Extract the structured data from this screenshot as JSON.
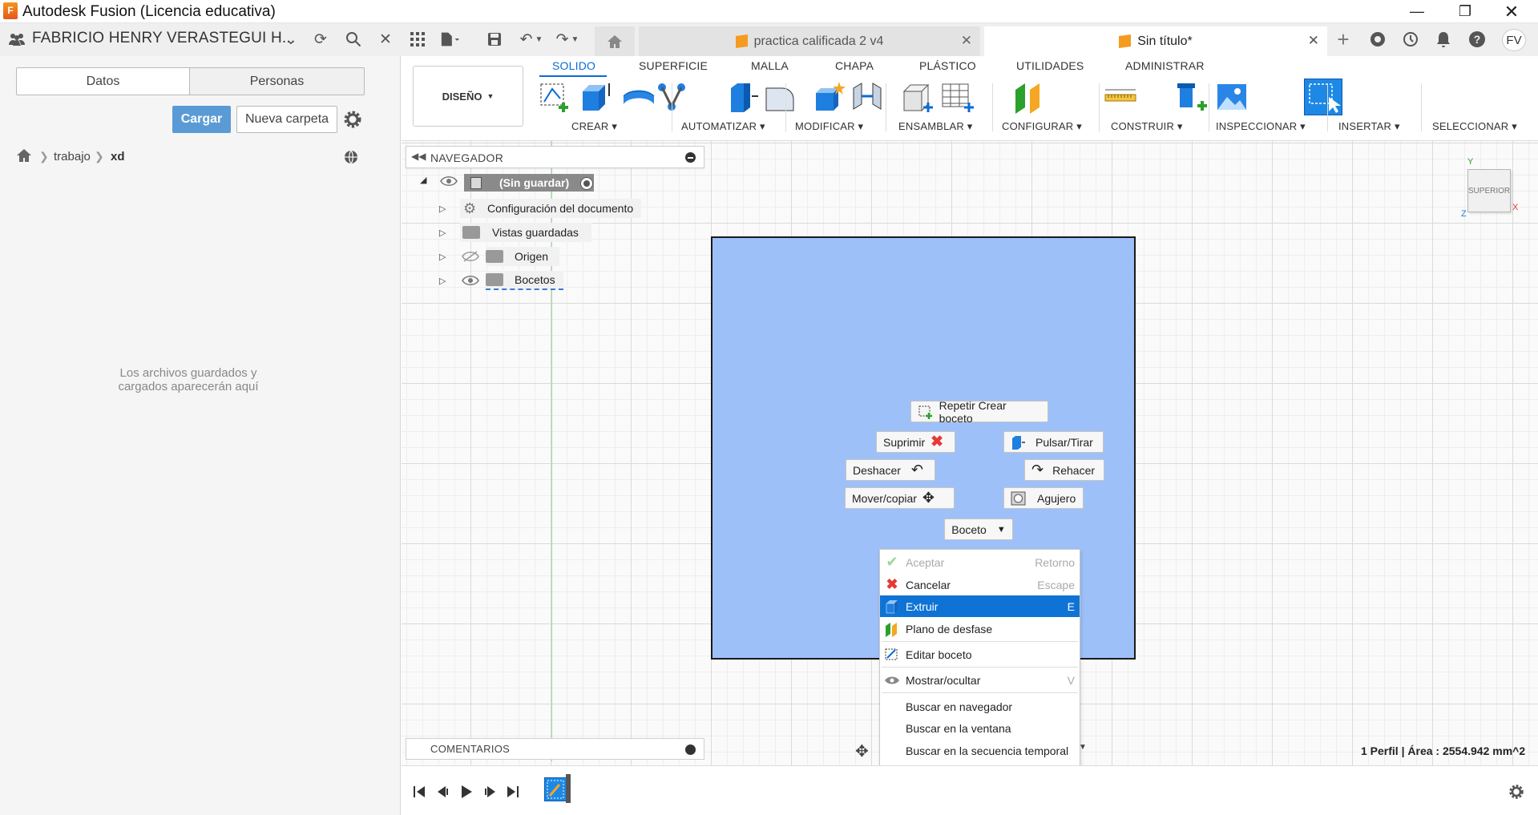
{
  "window": {
    "title": "Autodesk Fusion (Licencia educativa)"
  },
  "appbar": {
    "user": "FABRICIO HENRY VERASTEGUI H...",
    "avatar": "FV",
    "tabs": [
      {
        "label": "practica calificada 2 v4"
      },
      {
        "label": "Sin título*"
      }
    ]
  },
  "datapanel": {
    "tab_data": "Datos",
    "tab_people": "Personas",
    "upload": "Cargar",
    "new_folder": "Nueva carpeta",
    "breadcrumb": [
      "trabajo",
      "xd"
    ],
    "empty_message": "Los archivos guardados y cargados aparecerán aquí"
  },
  "workspace": {
    "label": "DISEÑO"
  },
  "ribbon": {
    "tabs": [
      "SOLIDO",
      "SUPERFICIE",
      "MALLA",
      "CHAPA",
      "PLÁSTICO",
      "UTILIDADES",
      "ADMINISTRAR"
    ],
    "groups": [
      "CREAR",
      "AUTOMATIZAR",
      "MODIFICAR",
      "ENSAMBLAR",
      "CONFIGURAR",
      "CONSTRUIR",
      "INSPECCIONAR",
      "INSERTAR",
      "SELECCIONAR"
    ]
  },
  "browser": {
    "title": "NAVEGADOR",
    "root": "(Sin guardar)",
    "items": [
      "Configuración del documento",
      "Vistas guardadas",
      "Origen",
      "Bocetos"
    ],
    "comments": "COMENTARIOS"
  },
  "viewcube": {
    "face": "SUPERIOR",
    "axis_y": "Y",
    "axis_x": "X",
    "axis_z": "Z"
  },
  "marking": {
    "repeat": "Repetir Crear boceto",
    "suppress": "Suprimir",
    "pushpull": "Pulsar/Tirar",
    "undo": "Deshacer",
    "redo": "Rehacer",
    "move": "Mover/copiar",
    "hole": "Agujero",
    "sketch": "Boceto"
  },
  "context_menu": [
    {
      "label": "Aceptar",
      "shortcut": "Retorno",
      "disabled": true
    },
    {
      "label": "Cancelar",
      "shortcut": "Escape"
    },
    {
      "label": "Extruir",
      "shortcut": "E",
      "highlight": true
    },
    {
      "label": "Plano de desfase",
      "shortcut": ""
    },
    {
      "label": "Editar boceto",
      "shortcut": ""
    },
    {
      "label": "Mostrar/ocultar",
      "shortcut": "V"
    },
    {
      "label": "Buscar en navegador",
      "shortcut": ""
    },
    {
      "label": "Buscar en la ventana",
      "shortcut": ""
    },
    {
      "label": "Buscar en la secuencia temporal",
      "shortcut": ""
    }
  ],
  "status": {
    "measure": "1 Perfil | Área : 2554.942 mm^2"
  },
  "colors": {
    "accent": "#0a6bd6",
    "highlight": "#0f73d6",
    "sketch_fill": "#9ec0f8",
    "upload_btn": "#5b9bd5"
  }
}
